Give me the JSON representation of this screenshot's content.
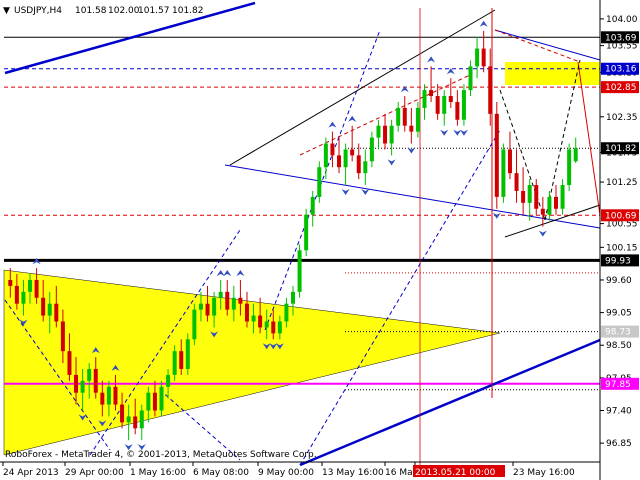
{
  "header": {
    "symbol": "USDJPY,H4",
    "open": "101.58",
    "high": "102.00",
    "low": "101.57",
    "close": "101.82"
  },
  "footer": {
    "copyright": "RoboForex - MetaTrader 4, © 2001-2013, MetaQuotes Software Corp."
  },
  "colors": {
    "background": "#ffffff",
    "bull_candle": "#00c000",
    "bear_candle": "#d00000",
    "channel_blue": "#0000cc",
    "resistance_red": "#dd0000",
    "support_black": "#000000",
    "triangle_yellow": "#ffff00",
    "magenta_level": "#ff00ff",
    "grid": "#c0c0c0"
  },
  "chart_data": {
    "type": "candlestick",
    "symbol": "USDJPY",
    "timeframe": "H4",
    "y_axis": {
      "min": 96.65,
      "max": 104.15,
      "ticks": [
        "104.00",
        "103.55",
        "103.10",
        "102.35",
        "101.75",
        "101.25",
        "100.55",
        "100.15",
        "99.60",
        "99.05",
        "98.50",
        "97.95",
        "97.40",
        "96.85"
      ]
    },
    "x_axis": {
      "ticks": [
        "24 Apr 2013",
        "29 Apr 00:00",
        "1 May 16:00",
        "6 May 08:00",
        "9 May 00:00",
        "13 May 16:00",
        "16 Ma",
        "2013.05.21 00:00",
        "23 May 16:00"
      ]
    },
    "price_labels": [
      {
        "text": "103.69",
        "value": 103.69,
        "style": "black"
      },
      {
        "text": "103.16",
        "value": 103.16,
        "style": "blue"
      },
      {
        "text": "102.85",
        "value": 102.85,
        "style": "red"
      },
      {
        "text": "101.82",
        "value": 101.82,
        "style": "black"
      },
      {
        "text": "100.69",
        "value": 100.69,
        "style": "red"
      },
      {
        "text": "99.93",
        "value": 99.93,
        "style": "black"
      },
      {
        "text": "98.73",
        "value": 98.73,
        "style": "gray"
      },
      {
        "text": "97.85",
        "value": 97.85,
        "style": "magenta"
      }
    ],
    "levels": [
      {
        "value": 103.69,
        "style": "solid-black"
      },
      {
        "value": 103.16,
        "style": "dashed-blue"
      },
      {
        "value": 102.85,
        "style": "dashed-red"
      },
      {
        "value": 101.82,
        "style": "dotted-gray"
      },
      {
        "value": 100.69,
        "style": "dashed-red"
      },
      {
        "value": 99.93,
        "style": "thick-black"
      },
      {
        "value": 99.72,
        "style": "dotted-red"
      },
      {
        "value": 98.73,
        "style": "dotted-gray"
      },
      {
        "value": 97.85,
        "style": "magenta"
      },
      {
        "value": 97.75,
        "style": "dotted-gray"
      }
    ],
    "candles": [
      {
        "o": 99.6,
        "h": 99.8,
        "l": 99.3,
        "c": 99.5
      },
      {
        "o": 99.5,
        "h": 99.7,
        "l": 99.1,
        "c": 99.2
      },
      {
        "o": 99.2,
        "h": 99.6,
        "l": 99.0,
        "c": 99.4
      },
      {
        "o": 99.4,
        "h": 99.7,
        "l": 99.2,
        "c": 99.6
      },
      {
        "o": 99.6,
        "h": 99.8,
        "l": 99.2,
        "c": 99.3
      },
      {
        "o": 99.3,
        "h": 99.6,
        "l": 98.9,
        "c": 99.0
      },
      {
        "o": 99.0,
        "h": 99.4,
        "l": 98.7,
        "c": 99.2
      },
      {
        "o": 99.2,
        "h": 99.5,
        "l": 98.8,
        "c": 98.9
      },
      {
        "o": 98.9,
        "h": 99.1,
        "l": 98.2,
        "c": 98.4
      },
      {
        "o": 98.4,
        "h": 98.7,
        "l": 97.9,
        "c": 98.0
      },
      {
        "o": 98.0,
        "h": 98.3,
        "l": 97.5,
        "c": 97.7
      },
      {
        "o": 97.7,
        "h": 98.1,
        "l": 97.4,
        "c": 97.9
      },
      {
        "o": 97.9,
        "h": 98.2,
        "l": 97.6,
        "c": 98.1
      },
      {
        "o": 98.1,
        "h": 98.3,
        "l": 97.6,
        "c": 97.7
      },
      {
        "o": 97.7,
        "h": 97.9,
        "l": 97.3,
        "c": 97.5
      },
      {
        "o": 97.5,
        "h": 97.9,
        "l": 97.3,
        "c": 97.8
      },
      {
        "o": 97.8,
        "h": 98.0,
        "l": 97.4,
        "c": 97.5
      },
      {
        "o": 97.5,
        "h": 97.7,
        "l": 97.1,
        "c": 97.2
      },
      {
        "o": 97.2,
        "h": 97.5,
        "l": 96.9,
        "c": 97.3
      },
      {
        "o": 97.3,
        "h": 97.6,
        "l": 97.0,
        "c": 97.1
      },
      {
        "o": 97.1,
        "h": 97.5,
        "l": 96.9,
        "c": 97.4
      },
      {
        "o": 97.4,
        "h": 97.8,
        "l": 97.2,
        "c": 97.7
      },
      {
        "o": 97.7,
        "h": 97.9,
        "l": 97.3,
        "c": 97.4
      },
      {
        "o": 97.4,
        "h": 97.9,
        "l": 97.3,
        "c": 97.8
      },
      {
        "o": 97.8,
        "h": 98.1,
        "l": 97.6,
        "c": 98.0
      },
      {
        "o": 98.0,
        "h": 98.5,
        "l": 97.9,
        "c": 98.4
      },
      {
        "o": 98.4,
        "h": 98.6,
        "l": 98.0,
        "c": 98.1
      },
      {
        "o": 98.1,
        "h": 98.7,
        "l": 98.0,
        "c": 98.6
      },
      {
        "o": 98.6,
        "h": 99.2,
        "l": 98.5,
        "c": 99.1
      },
      {
        "o": 99.1,
        "h": 99.4,
        "l": 98.9,
        "c": 99.2
      },
      {
        "o": 99.2,
        "h": 99.5,
        "l": 98.9,
        "c": 99.0
      },
      {
        "o": 99.0,
        "h": 99.4,
        "l": 98.8,
        "c": 99.3
      },
      {
        "o": 99.3,
        "h": 99.6,
        "l": 99.1,
        "c": 99.4
      },
      {
        "o": 99.4,
        "h": 99.6,
        "l": 99.0,
        "c": 99.1
      },
      {
        "o": 99.1,
        "h": 99.5,
        "l": 98.9,
        "c": 99.3
      },
      {
        "o": 99.3,
        "h": 99.6,
        "l": 99.0,
        "c": 99.2
      },
      {
        "o": 99.2,
        "h": 99.4,
        "l": 98.8,
        "c": 98.9
      },
      {
        "o": 98.9,
        "h": 99.2,
        "l": 98.7,
        "c": 99.0
      },
      {
        "o": 99.0,
        "h": 99.3,
        "l": 98.7,
        "c": 98.8
      },
      {
        "o": 98.8,
        "h": 99.1,
        "l": 98.6,
        "c": 98.9
      },
      {
        "o": 98.9,
        "h": 99.1,
        "l": 98.6,
        "c": 98.7
      },
      {
        "o": 98.7,
        "h": 99.0,
        "l": 98.6,
        "c": 98.9
      },
      {
        "o": 98.9,
        "h": 99.3,
        "l": 98.8,
        "c": 99.2
      },
      {
        "o": 99.2,
        "h": 99.5,
        "l": 99.0,
        "c": 99.4
      },
      {
        "o": 99.4,
        "h": 100.2,
        "l": 99.3,
        "c": 100.1
      },
      {
        "o": 100.1,
        "h": 100.8,
        "l": 100.0,
        "c": 100.7
      },
      {
        "o": 100.7,
        "h": 101.1,
        "l": 100.5,
        "c": 101.0
      },
      {
        "o": 101.0,
        "h": 101.6,
        "l": 100.9,
        "c": 101.5
      },
      {
        "o": 101.5,
        "h": 102.0,
        "l": 101.3,
        "c": 101.9
      },
      {
        "o": 101.9,
        "h": 102.1,
        "l": 101.5,
        "c": 101.7
      },
      {
        "o": 101.7,
        "h": 102.0,
        "l": 101.4,
        "c": 101.5
      },
      {
        "o": 101.5,
        "h": 101.9,
        "l": 101.2,
        "c": 101.8
      },
      {
        "o": 101.8,
        "h": 102.2,
        "l": 101.6,
        "c": 101.7
      },
      {
        "o": 101.7,
        "h": 101.9,
        "l": 101.3,
        "c": 101.4
      },
      {
        "o": 101.4,
        "h": 101.8,
        "l": 101.2,
        "c": 101.6
      },
      {
        "o": 101.6,
        "h": 102.1,
        "l": 101.5,
        "c": 102.0
      },
      {
        "o": 102.0,
        "h": 102.3,
        "l": 101.8,
        "c": 102.2
      },
      {
        "o": 102.2,
        "h": 102.4,
        "l": 101.8,
        "c": 101.9
      },
      {
        "o": 101.9,
        "h": 102.3,
        "l": 101.7,
        "c": 102.2
      },
      {
        "o": 102.2,
        "h": 102.6,
        "l": 102.1,
        "c": 102.5
      },
      {
        "o": 102.5,
        "h": 102.7,
        "l": 102.1,
        "c": 102.2
      },
      {
        "o": 102.2,
        "h": 102.5,
        "l": 101.9,
        "c": 102.1
      },
      {
        "o": 102.1,
        "h": 102.6,
        "l": 102.0,
        "c": 102.5
      },
      {
        "o": 102.5,
        "h": 102.9,
        "l": 102.3,
        "c": 102.8
      },
      {
        "o": 102.8,
        "h": 103.2,
        "l": 102.6,
        "c": 102.7
      },
      {
        "o": 102.7,
        "h": 102.9,
        "l": 102.3,
        "c": 102.4
      },
      {
        "o": 102.4,
        "h": 102.8,
        "l": 102.2,
        "c": 102.7
      },
      {
        "o": 102.7,
        "h": 103.0,
        "l": 102.5,
        "c": 102.6
      },
      {
        "o": 102.6,
        "h": 102.8,
        "l": 102.2,
        "c": 102.3
      },
      {
        "o": 102.3,
        "h": 102.9,
        "l": 102.2,
        "c": 102.8
      },
      {
        "o": 102.8,
        "h": 103.3,
        "l": 102.7,
        "c": 103.2
      },
      {
        "o": 103.2,
        "h": 103.7,
        "l": 103.0,
        "c": 103.5
      },
      {
        "o": 103.5,
        "h": 103.8,
        "l": 103.1,
        "c": 103.2
      },
      {
        "o": 103.2,
        "h": 103.5,
        "l": 102.2,
        "c": 102.4
      },
      {
        "o": 102.4,
        "h": 102.6,
        "l": 100.8,
        "c": 101.0
      },
      {
        "o": 101.0,
        "h": 101.9,
        "l": 100.9,
        "c": 101.8
      },
      {
        "o": 101.8,
        "h": 102.1,
        "l": 101.3,
        "c": 101.4
      },
      {
        "o": 101.4,
        "h": 101.8,
        "l": 100.9,
        "c": 101.1
      },
      {
        "o": 101.1,
        "h": 101.5,
        "l": 100.7,
        "c": 100.9
      },
      {
        "o": 100.9,
        "h": 101.3,
        "l": 100.6,
        "c": 101.2
      },
      {
        "o": 101.2,
        "h": 101.3,
        "l": 100.7,
        "c": 100.8
      },
      {
        "o": 100.8,
        "h": 101.0,
        "l": 100.5,
        "c": 100.7
      },
      {
        "o": 100.7,
        "h": 101.1,
        "l": 100.6,
        "c": 101.0
      },
      {
        "o": 101.0,
        "h": 101.2,
        "l": 100.7,
        "c": 100.8
      },
      {
        "o": 100.8,
        "h": 101.3,
        "l": 100.7,
        "c": 101.2
      },
      {
        "o": 101.2,
        "h": 101.9,
        "l": 101.1,
        "c": 101.8
      },
      {
        "o": 101.6,
        "h": 102.0,
        "l": 101.57,
        "c": 101.82
      }
    ]
  }
}
